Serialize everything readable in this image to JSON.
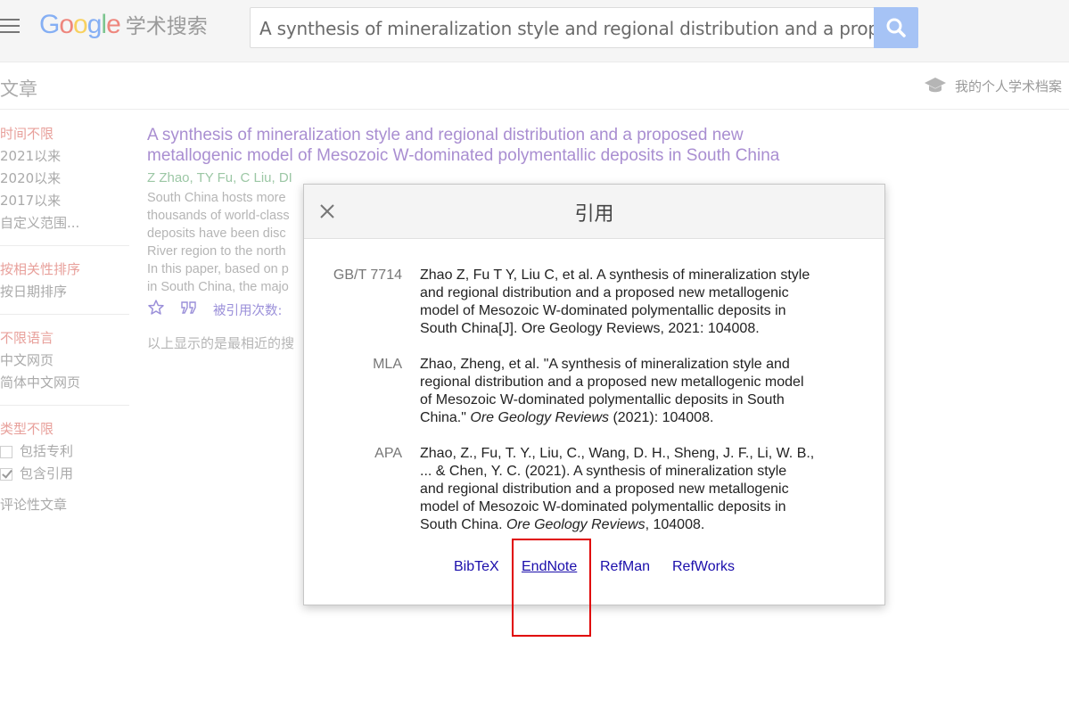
{
  "header": {
    "logo_text": "Google",
    "logo_sub": "学术搜索",
    "search_value": "A synthesis of mineralization style and regional distribution and a proposed new metallogenic model of Mesozoic W-dominated polymentallic deposits in South China"
  },
  "subheader": {
    "title": "文章",
    "profile_link": "我的个人学术档案"
  },
  "sidebar": {
    "time": [
      "时间不限",
      "2021以来",
      "2020以来",
      "2017以来",
      "自定义范围..."
    ],
    "sort": [
      "按相关性排序",
      "按日期排序"
    ],
    "language": [
      "不限语言",
      "中文网页",
      "简体中文网页"
    ],
    "type": [
      "类型不限",
      "包括专利",
      "包含引用"
    ],
    "review": "评论性文章"
  },
  "result": {
    "title": "A synthesis of mineralization style and regional distribution and a proposed new metallogenic model of Mesozoic W-dominated polymentallic deposits in South China",
    "authors": "Z Zhao, TY Fu, C Liu, DI",
    "snippet": [
      "South China hosts more",
      "thousands of world-class",
      "deposits have been disc",
      "River region to the north",
      "In this paper, based on p",
      "in South China, the majo"
    ],
    "cited_by": "被引用次数:",
    "note": "以上显示的是最相近的搜"
  },
  "modal": {
    "title": "引用",
    "citations": [
      {
        "label": "GB/T 7714",
        "lines": [
          "Zhao Z, Fu T Y, Liu C, et al. A synthesis of mineralization style",
          "and regional distribution and a proposed new metallogenic",
          "model of Mesozoic W-dominated polymentallic deposits in",
          "South China[J]. Ore Geology Reviews, 2021: 104008."
        ]
      },
      {
        "label": "MLA",
        "lines": [
          "Zhao, Zheng, et al. \"A synthesis of mineralization style and",
          "regional distribution and a proposed new metallogenic model",
          "of Mesozoic W-dominated polymentallic deposits in South"
        ],
        "last_pre": "China.\" ",
        "last_journal": "Ore Geology Reviews",
        "last_post": " (2021): 104008."
      },
      {
        "label": "APA",
        "lines": [
          "Zhao, Z., Fu, T. Y., Liu, C., Wang, D. H., Sheng, J. F., Li, W. B.,",
          "... & Chen, Y. C. (2021). A synthesis of mineralization style",
          "and regional distribution and a proposed new metallogenic",
          "model of Mesozoic W-dominated polymentallic deposits in"
        ],
        "last_pre": "South China. ",
        "last_journal": "Ore Geology Reviews",
        "last_post": ", 104008."
      }
    ],
    "links": [
      "BibTeX",
      "EndNote",
      "RefMan",
      "RefWorks"
    ]
  },
  "colors": {
    "link": "#1a0dab",
    "title_link": "#a98ed1",
    "highlight": "#e00000",
    "search_button": "#a6c3f5"
  }
}
